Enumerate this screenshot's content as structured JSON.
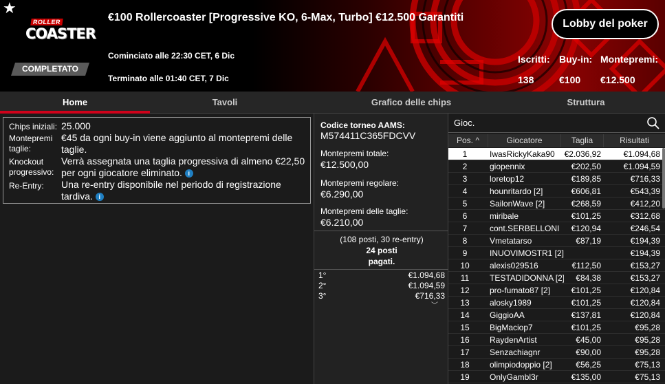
{
  "header": {
    "title": "€100 Rollercoaster [Progressive KO, 6-Max, Turbo] €12.500 Garantiti",
    "logo_top": "ROLLER",
    "logo_bottom": "COASTER",
    "status": "COMPLETATO",
    "started": "Cominciato alle 22:30 CET, 6 Dic",
    "ended": "Terminato alle 01:40 CET, 7 Dic",
    "lobby_button": "Lobby del poker",
    "stats": {
      "entries_label": "Iscritti:",
      "entries_value": "138",
      "buyin_label": "Buy-in:",
      "buyin_value": "€100",
      "prizepool_label": "Montepremi:",
      "prizepool_value": "€12.500"
    }
  },
  "tabs": [
    "Home",
    "Tavoli",
    "Grafico delle chips",
    "Struttura"
  ],
  "info": {
    "chips_label": "Chips iniziali:",
    "chips_value": "25.000",
    "bounty_pool_label_1": "Montepremi",
    "bounty_pool_label_2": "taglie:",
    "bounty_pool_value": "€45 da ogni buy-in viene aggiunto al montepremi delle taglie.",
    "ko_label_1": "Knockout",
    "ko_label_2": "progressivo:",
    "ko_value": "Verrà assegnata una taglia progressiva di almeno €22,50 per ogni giocatore eliminato.",
    "reentry_label": "Re-Entry:",
    "reentry_value": "Una re-entry disponibile nel periodo di registrazione tardiva."
  },
  "summary": {
    "aams_label": "Codice torneo AAMS:",
    "aams_value": "M574411C365FDCVV",
    "total_label": "Montepremi totale:",
    "total_value": "€12.500,00",
    "regular_label": "Montepremi regolare:",
    "regular_value": "€6.290,00",
    "bounty_label": "Montepremi delle taglie:",
    "bounty_value": "€6.210,00",
    "places_text": "(108 posti, 30 re-entry)",
    "paid_text_1": "24 posti",
    "paid_text_2": "pagati."
  },
  "prizes": [
    {
      "pos": "1°",
      "amount": "€1.094,68"
    },
    {
      "pos": "2°",
      "amount": "€1.094,59"
    },
    {
      "pos": "3°",
      "amount": "€716,33"
    }
  ],
  "players": {
    "search_label": "Gioc.",
    "columns": [
      "Pos.",
      "Giocatore",
      "Taglia",
      "Risultati"
    ],
    "rows": [
      {
        "pos": "1",
        "name": "IwasRickyKaka90",
        "bounty": "€2.036,92",
        "result": "€1.094,68"
      },
      {
        "pos": "2",
        "name": "giopennix",
        "bounty": "€202,50",
        "result": "€1.094,59"
      },
      {
        "pos": "3",
        "name": "loretop12",
        "bounty": "€189,85",
        "result": "€716,33"
      },
      {
        "pos": "4",
        "name": "hounritardo [2]",
        "bounty": "€606,81",
        "result": "€543,39"
      },
      {
        "pos": "5",
        "name": "SailonWave [2]",
        "bounty": "€268,59",
        "result": "€412,20"
      },
      {
        "pos": "6",
        "name": "miribale",
        "bounty": "€101,25",
        "result": "€312,68"
      },
      {
        "pos": "7",
        "name": "cont.SERBELLONI",
        "bounty": "€120,94",
        "result": "€246,54"
      },
      {
        "pos": "8",
        "name": "Vmetatarso",
        "bounty": "€87,19",
        "result": "€194,39"
      },
      {
        "pos": "9",
        "name": "INUOVIMOSTR1 [2]",
        "bounty": "",
        "result": "€194,39"
      },
      {
        "pos": "10",
        "name": "alexis029516",
        "bounty": "€112,50",
        "result": "€153,27"
      },
      {
        "pos": "11",
        "name": "TESTADIDONNA [2]",
        "bounty": "€84,38",
        "result": "€153,27"
      },
      {
        "pos": "12",
        "name": "pro-fumato87 [2]",
        "bounty": "€101,25",
        "result": "€120,84"
      },
      {
        "pos": "13",
        "name": "alosky1989",
        "bounty": "€101,25",
        "result": "€120,84"
      },
      {
        "pos": "14",
        "name": "GiggioAA",
        "bounty": "€137,81",
        "result": "€120,84"
      },
      {
        "pos": "15",
        "name": "BigMaciop7",
        "bounty": "€101,25",
        "result": "€95,28"
      },
      {
        "pos": "16",
        "name": "RaydenArtist",
        "bounty": "€45,00",
        "result": "€95,28"
      },
      {
        "pos": "17",
        "name": "Senzachiagnr",
        "bounty": "€90,00",
        "result": "€95,28"
      },
      {
        "pos": "18",
        "name": "olimpiodoppio [2]",
        "bounty": "€56,25",
        "result": "€75,13"
      },
      {
        "pos": "19",
        "name": "OnlyGambl3r",
        "bounty": "€135,00",
        "result": "€75,13"
      }
    ]
  },
  "colors": {
    "accent": "#d0021b",
    "info_icon": "#1f7fc2",
    "background": "#1b1b1b"
  }
}
